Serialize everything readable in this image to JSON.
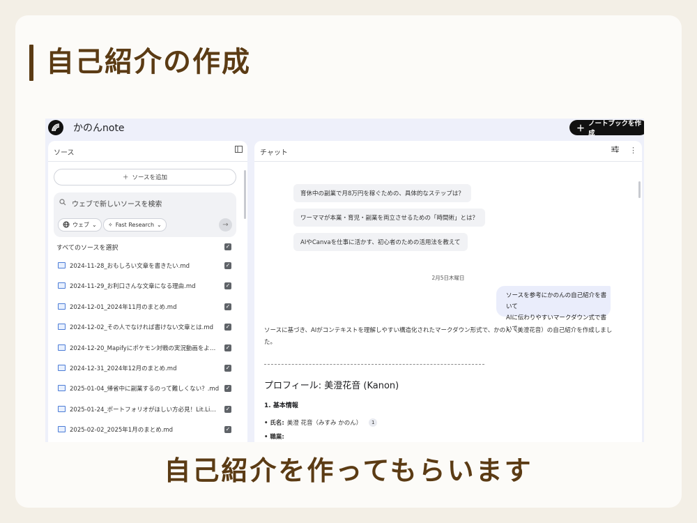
{
  "slide": {
    "heading": "自己紹介の作成",
    "caption": "自己紹介を作ってもらいます"
  },
  "app": {
    "title": "かのんnote",
    "new_notebook_label": "ノートブックを作成"
  },
  "sources_panel": {
    "title": "ソース",
    "add_source_label": "ソースを追加",
    "search_placeholder": "ウェブで新しいソースを検索",
    "chip_web": "ウェブ",
    "chip_research": "Fast Research",
    "select_all_label": "すべてのソースを選択",
    "items": [
      {
        "name": "2024-11-28_おもしろい文章を書きたい.md"
      },
      {
        "name": "2024-11-29_お利口さんな文章になる理由.md"
      },
      {
        "name": "2024-12-01_2024年11月のまとめ.md"
      },
      {
        "name": "2024-12-02_その人でなければ書けない文章とは.md"
      },
      {
        "name": "2024-12-20_Mapifyにポケモン対戦の実況動画をよみ..."
      },
      {
        "name": "2024-12-31_2024年12月のまとめ.md"
      },
      {
        "name": "2025-01-04_帰省中に副業するのって難しくない？.md"
      },
      {
        "name": "2025-01-24_ポートフォリオがほしい方必見！Lit.Link..."
      },
      {
        "name": "2025-02-02_2025年1月のまとめ.md"
      }
    ]
  },
  "chat_panel": {
    "title": "チャット",
    "suggestions": [
      "育休中の副業で月8万円を稼ぐための、具体的なステップは？",
      "ワーママが本業・育児・副業を両立させるための「時間術」とは？",
      "AIやCanvaを仕事に活かす、初心者のための活用法を教えて"
    ],
    "date_separator": "2月5日木曜日",
    "user_message_line1": "ソースを参考にかのんの自己紹介を書いて",
    "user_message_line2": "AIに伝わりやすいマークダウン式で書いて",
    "response_intro": "ソースに基づき、AIがコンテキストを理解しやすい構造化されたマークダウン形式で、かのん（美澄花音）の自己紹介を作成しました。",
    "divider": "--------------------------------------------------------------------------------",
    "profile_heading": "プロフィール: 美澄花音 (Kanon)",
    "section_basic": "1. 基本情報",
    "name_label": "• 氏名:",
    "name_value": "美澄 花音（みすみ かのん）",
    "citation_number": "1",
    "job_label": "• 職業:"
  }
}
